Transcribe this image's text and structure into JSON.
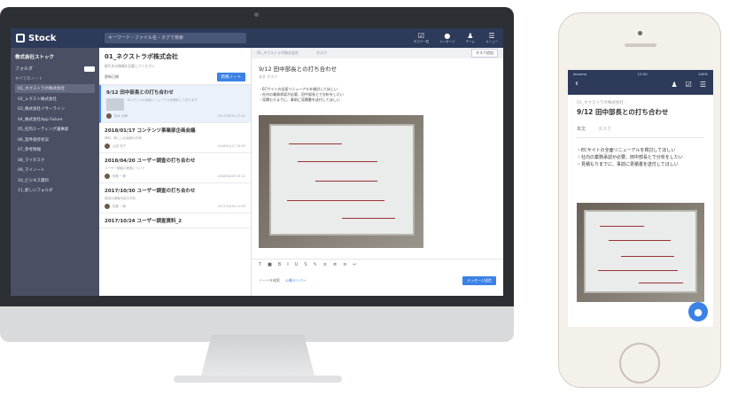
{
  "app": {
    "logo_text": "Stock",
    "search_placeholder": "キーワード・ファイル名・タグで検索",
    "top_icons": [
      {
        "icon": "checklist-icon",
        "label": "タスク一覧"
      },
      {
        "icon": "chat-icon",
        "label": "メッセージ"
      },
      {
        "icon": "team-icon",
        "label": "チーム"
      },
      {
        "icon": "menu-icon",
        "label": "メニュー"
      }
    ]
  },
  "sidebar": {
    "company": "株式会社ストック",
    "folder_label": "フォルダ",
    "section": "すべてのノート",
    "items": [
      "01_ネクストラボ株式会社",
      "02_レクスト株式会社",
      "03_株式会社イサーライン",
      "04_株式会社App Future",
      "05_社内ミーティング議事録",
      "06_案件進捗状況",
      "07_参考情報",
      "08_マイタスク",
      "09_マイノート",
      "10_ビジネス資料",
      "11_新しいフォルダ"
    ]
  },
  "list": {
    "title": "01_ネクストラボ株式会社",
    "description": "取引先の情報を記載してください",
    "sort_label": "更新日順",
    "new_button": "新規ノート",
    "notes": [
      {
        "title": "9/12 田中部長との打ち合わせ",
        "text": "EC サイトの全面リニューアルを検討しております",
        "author": "鈴木 太郎",
        "date": "2017/09/12 17:41"
      },
      {
        "title": "2018/01/17 コンテンツ事業部企画会議",
        "text": "資料・新しい企画案の共有",
        "author": "山田 花子",
        "date": "2018/01/17 10:30"
      },
      {
        "title": "2018/04/20 ユーザー調査の打ち合わせ",
        "text": "ユーザー調査の実施について",
        "author": "佐藤 一郎",
        "date": "2018/04/20 15:12"
      },
      {
        "title": "2017/10/30 ユーザー調査の打ち合わせ",
        "text": "前回の調査内容の共有",
        "author": "佐藤 一郎",
        "date": "2017/10/30 11:05"
      },
      {
        "title": "2017/10/24 ユーザー調査資料_2",
        "text": "",
        "author": "",
        "date": ""
      }
    ]
  },
  "editor": {
    "breadcrumb": "01_ネクストラボ株式会社",
    "tab_task": "タスク",
    "share_button": "タスク追加",
    "title": "9/12 田中部長との打ち合わせ",
    "subtitle": "本文  タスク",
    "body": [
      "・ECサイトの全面リニューアルを検討してほしい",
      "・社内の業務承認が必要、田中部長とで分析をしたい",
      "・見積もりまでに、事前に見積書を送付してほしい"
    ],
    "toolbar_icons": [
      "T",
      "■",
      "B",
      "I",
      "U",
      "S",
      "✎",
      "≡",
      "≣",
      "≡",
      "↩",
      "⌂"
    ],
    "footer_text": "ノートを検索",
    "footer_label": "公開メンバー",
    "message_button": "メッセージ送信"
  },
  "phone": {
    "status_left": "docomo",
    "status_time": "12:00",
    "status_right": "100%",
    "breadcrumb": "01_ネクストラボ株式会社  ›",
    "title": "9/12 田中部長との打ち合わせ",
    "tab_active": "本文",
    "tab_inactive": "タスク",
    "body": [
      "・ECサイトの全面リニューアルを検討してほしい",
      "・社内の業務承認が必要、田中部長とで分析をしたい",
      "・見積もりまでに、事前に見積書を送付してほしい"
    ]
  },
  "colors": {
    "header": "#2d3a5a",
    "sidebar": "#4a4f64",
    "accent": "#3b82e6"
  }
}
